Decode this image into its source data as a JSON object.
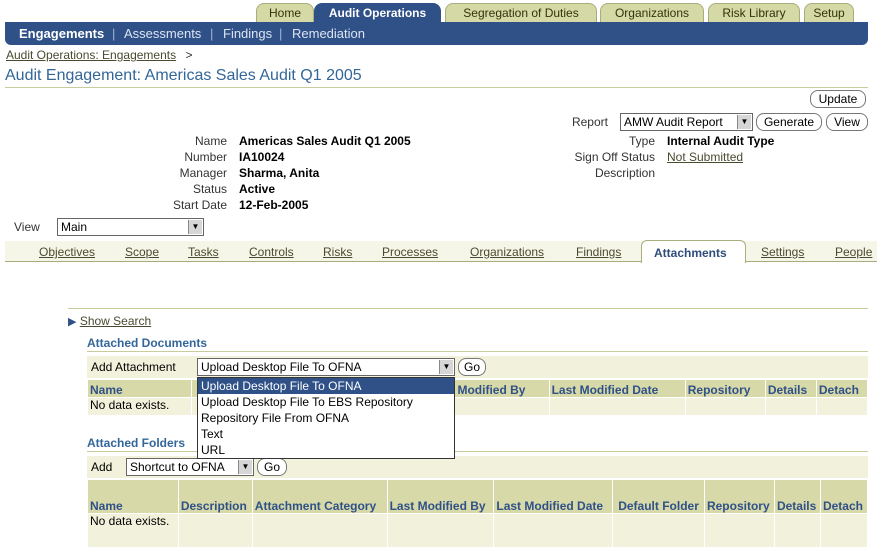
{
  "top_tabs": [
    "Home",
    "Audit Operations",
    "Segregation of Duties",
    "Organizations",
    "Risk Library",
    "Setup"
  ],
  "top_tab_active": 1,
  "nav": [
    "Engagements",
    "Assessments",
    "Findings",
    "Remediation"
  ],
  "breadcrumb": {
    "link": "Audit Operations: Engagements",
    "sep": ">"
  },
  "page_title": "Audit Engagement: Americas Sales Audit Q1 2005",
  "buttons": {
    "update": "Update",
    "generate": "Generate",
    "view": "View",
    "go": "Go"
  },
  "report": {
    "label": "Report",
    "value": "AMW Audit Report"
  },
  "fields": {
    "name": {
      "label": "Name",
      "value": "Americas Sales Audit Q1 2005"
    },
    "number": {
      "label": "Number",
      "value": "IA10024"
    },
    "manager": {
      "label": "Manager",
      "value": "Sharma, Anita"
    },
    "status": {
      "label": "Status",
      "value": "Active"
    },
    "start_date": {
      "label": "Start Date",
      "value": "12-Feb-2005"
    },
    "type": {
      "label": "Type",
      "value": "Internal Audit Type"
    },
    "sign_off": {
      "label": "Sign Off Status",
      "value": "Not Submitted"
    },
    "description": {
      "label": "Description",
      "value": ""
    }
  },
  "view": {
    "label": "View",
    "value": "Main"
  },
  "sub_tabs": [
    "Objectives",
    "Scope",
    "Tasks",
    "Controls",
    "Risks",
    "Processes",
    "Organizations",
    "Findings",
    "Attachments",
    "Settings",
    "People"
  ],
  "sub_tab_active": 8,
  "show_search": "Show Search",
  "attached_documents": {
    "header": "Attached Documents",
    "add_label": "Add Attachment",
    "add_value": "Upload Desktop File To OFNA",
    "columns": [
      "Name",
      "",
      "Modified By",
      "Last Modified Date",
      "Repository",
      "Details",
      "Detach"
    ],
    "empty": "No data exists."
  },
  "dropdown_options": [
    "Upload Desktop File To OFNA",
    "Upload Desktop File To EBS Repository",
    "Repository File From OFNA",
    "Text",
    "URL"
  ],
  "attached_folders": {
    "header": "Attached Folders",
    "add_label": "Add",
    "add_value": "Shortcut to OFNA",
    "columns": [
      "Name",
      "Description",
      "Attachment Category",
      "Last Modified By",
      "Last Modified Date",
      "Default Folder",
      "Repository",
      "Details",
      "Detach"
    ],
    "empty": "No data exists."
  },
  "colors": {
    "brand": "#2f5188",
    "tab": "#d4d9a6",
    "header_cell": "#d8d9a8",
    "cell": "#f2f2dc"
  }
}
